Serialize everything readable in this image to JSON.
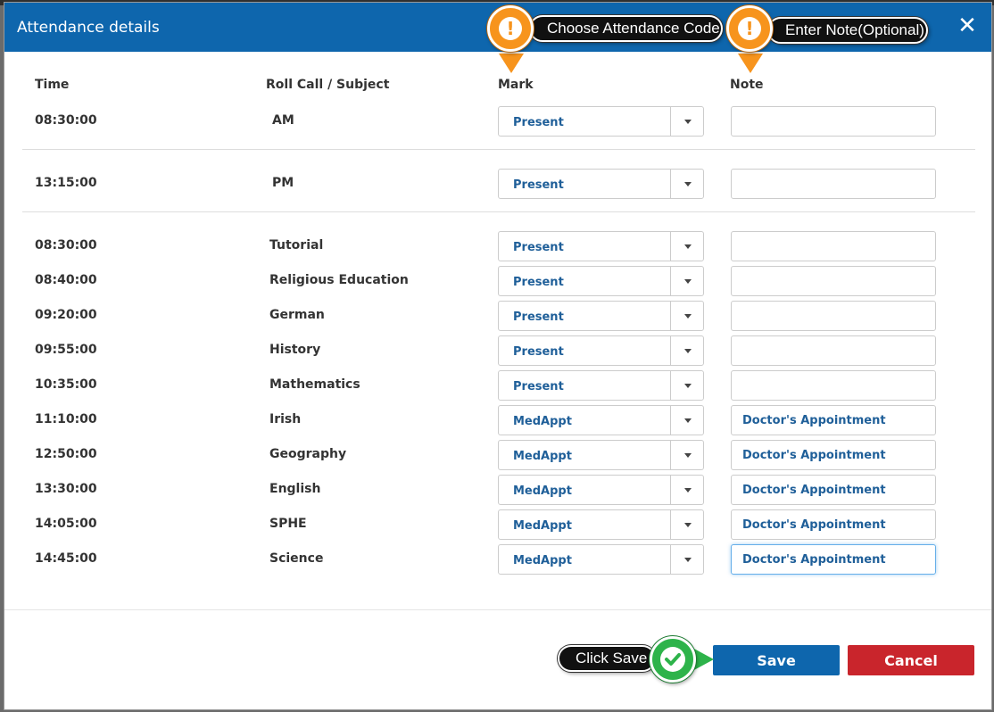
{
  "modal": {
    "title": "Attendance details",
    "close_glyph": "✕"
  },
  "columns": {
    "time": "Time",
    "subject": "Roll Call / Subject",
    "mark": "Mark",
    "note": "Note"
  },
  "roll_calls": [
    {
      "time": "08:30:00",
      "subject": "AM",
      "mark": "Present",
      "note": ""
    },
    {
      "time": "13:15:00",
      "subject": "PM",
      "mark": "Present",
      "note": ""
    }
  ],
  "subjects": [
    {
      "time": "08:30:00",
      "subject": "Tutorial",
      "mark": "Present",
      "note": ""
    },
    {
      "time": "08:40:00",
      "subject": "Religious Education",
      "mark": "Present",
      "note": ""
    },
    {
      "time": "09:20:00",
      "subject": "German",
      "mark": "Present",
      "note": ""
    },
    {
      "time": "09:55:00",
      "subject": "History",
      "mark": "Present",
      "note": ""
    },
    {
      "time": "10:35:00",
      "subject": "Mathematics",
      "mark": "Present",
      "note": ""
    },
    {
      "time": "11:10:00",
      "subject": "Irish",
      "mark": "MedAppt",
      "note": "Doctor's Appointment"
    },
    {
      "time": "12:50:00",
      "subject": "Geography",
      "mark": "MedAppt",
      "note": "Doctor's Appointment"
    },
    {
      "time": "13:30:00",
      "subject": "English",
      "mark": "MedAppt",
      "note": "Doctor's Appointment"
    },
    {
      "time": "14:05:00",
      "subject": "SPHE",
      "mark": "MedAppt",
      "note": "Doctor's Appointment"
    },
    {
      "time": "14:45:00",
      "subject": "Science",
      "mark": "MedAppt",
      "note": "Doctor's Appointment"
    }
  ],
  "buttons": {
    "save": "Save",
    "cancel": "Cancel"
  },
  "tooltips": {
    "choose_code": "Choose Attendance Code",
    "enter_note": "Enter Note(Optional)",
    "click_save": "Click Save",
    "warn_glyph": "!"
  },
  "colors": {
    "header": "#0e66ad",
    "save": "#0e66ad",
    "cancel": "#c9252c",
    "warn": "#f7941d",
    "ok": "#2db34a"
  }
}
